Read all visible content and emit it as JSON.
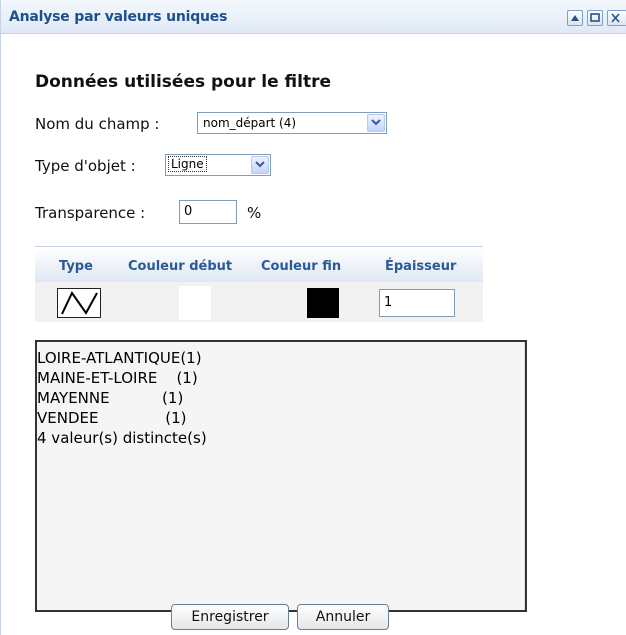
{
  "window": {
    "title": "Analyse par valeurs uniques"
  },
  "title_buttons": {
    "minimize_icon": "triangle-up-icon",
    "maximize_icon": "square-icon",
    "close_icon": "close-icon"
  },
  "section": {
    "title": "Données utilisées pour le filtre"
  },
  "field": {
    "label": "Nom du champ :",
    "value": "nom_départ (4)"
  },
  "object_type": {
    "label": "Type d'objet :",
    "value": "Ligne"
  },
  "transparency": {
    "label": "Transparence :",
    "value": "0",
    "unit": "%"
  },
  "grid": {
    "headers": [
      "Type",
      "Couleur début",
      "Couleur fin",
      "Épaisseur"
    ],
    "row": {
      "type_icon": "line-symbol-icon",
      "start_color": "#ffffff",
      "end_color": "#000000",
      "thickness": "1"
    }
  },
  "values_list": {
    "items": [
      "LOIRE-ATLANTIQUE(1)",
      "MAINE-ET-LOIRE    (1)",
      "MAYENNE           (1)",
      "VENDEE              (1)",
      "4 valeur(s) distincte(s)"
    ]
  },
  "buttons": {
    "save": "Enregistrer",
    "cancel": "Annuler"
  }
}
